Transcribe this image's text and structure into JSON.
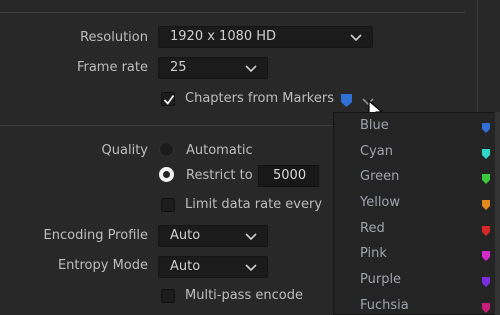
{
  "resolution": {
    "label": "Resolution",
    "value": "1920 x 1080 HD"
  },
  "frame_rate": {
    "label": "Frame rate",
    "value": "25"
  },
  "chapters": {
    "label": "Chapters from Markers",
    "checked": true,
    "marker_color": "#2f6fd6"
  },
  "quality": {
    "label": "Quality",
    "automatic_label": "Automatic",
    "restrict_label": "Restrict to",
    "restrict_value": "5000",
    "selected": "restrict"
  },
  "limit_rate": {
    "label": "Limit data rate every",
    "checked": false
  },
  "encoding_profile": {
    "label": "Encoding Profile",
    "value": "Auto"
  },
  "entropy_mode": {
    "label": "Entropy Mode",
    "value": "Auto"
  },
  "multipass": {
    "label": "Multi-pass encode",
    "checked": false
  },
  "marker_menu": {
    "items": [
      {
        "label": "Blue",
        "color": "#2f6fd6"
      },
      {
        "label": "Cyan",
        "color": "#2fd6c8"
      },
      {
        "label": "Green",
        "color": "#3cc83c"
      },
      {
        "label": "Yellow",
        "color": "#e08a1e"
      },
      {
        "label": "Red",
        "color": "#d42828"
      },
      {
        "label": "Pink",
        "color": "#d22cc8"
      },
      {
        "label": "Purple",
        "color": "#7a2ce0"
      },
      {
        "label": "Fuchsia",
        "color": "#c81e78"
      }
    ]
  }
}
